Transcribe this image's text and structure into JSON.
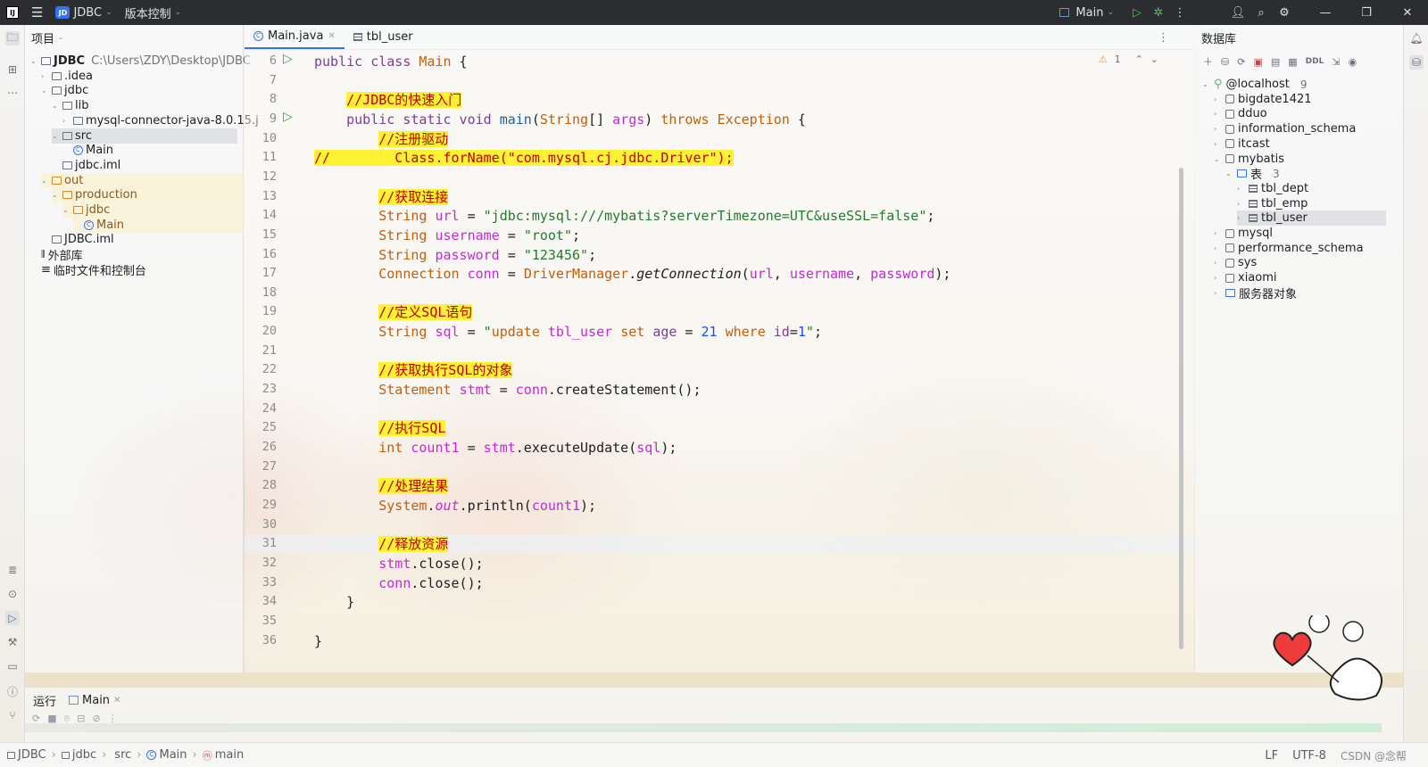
{
  "titlebar": {
    "project_badge": "JD",
    "project": "JDBC",
    "vcs": "版本控制",
    "run_config": "Main"
  },
  "project_panel": {
    "title": "项目",
    "tree": [
      {
        "label": "JDBC",
        "path": "C:\\Users\\ZDY\\Desktop\\JDBC",
        "depth": 0,
        "type": "module",
        "open": true
      },
      {
        "label": ".idea",
        "depth": 1,
        "type": "folder",
        "open": false
      },
      {
        "label": "jdbc",
        "depth": 1,
        "type": "module",
        "open": true
      },
      {
        "label": "lib",
        "depth": 2,
        "type": "folder",
        "open": true
      },
      {
        "label": "mysql-connector-java-8.0.15.j",
        "depth": 3,
        "type": "jar",
        "open": false
      },
      {
        "label": "src",
        "depth": 2,
        "type": "folder",
        "open": true,
        "selected": true
      },
      {
        "label": "Main",
        "depth": 3,
        "type": "class"
      },
      {
        "label": "jdbc.iml",
        "depth": 2,
        "type": "file"
      },
      {
        "label": "out",
        "depth": 1,
        "type": "folder",
        "open": true,
        "excluded": true
      },
      {
        "label": "production",
        "depth": 2,
        "type": "folder",
        "open": true,
        "excluded": true
      },
      {
        "label": "jdbc",
        "depth": 3,
        "type": "folder",
        "open": true,
        "excluded": true
      },
      {
        "label": "Main",
        "depth": 4,
        "type": "class",
        "excluded": true
      },
      {
        "label": "JDBC.iml",
        "depth": 1,
        "type": "file"
      },
      {
        "label": "外部库",
        "depth": 0,
        "type": "lib"
      },
      {
        "label": "临时文件和控制台",
        "depth": 0,
        "type": "scratch"
      }
    ]
  },
  "editor": {
    "tabs": [
      {
        "label": "Main.java",
        "active": true
      },
      {
        "label": "tbl_user",
        "active": false
      }
    ],
    "warnings": "1",
    "line_numbers": [
      "6",
      "7",
      "8",
      "9",
      "10",
      "11",
      "12",
      "13",
      "14",
      "15",
      "16",
      "17",
      "18",
      "19",
      "20",
      "21",
      "22",
      "23",
      "24",
      "25",
      "26",
      "27",
      "28",
      "29",
      "30",
      "31",
      "32",
      "33",
      "34",
      "35",
      "36"
    ],
    "code_lines": [
      [
        [
          "kw",
          "public class "
        ],
        [
          "cls",
          "Main"
        ],
        [
          "",
          " {"
        ]
      ],
      [],
      [
        [
          "",
          "    "
        ],
        [
          "cmt",
          "//JDBC的快速入门"
        ]
      ],
      [
        [
          "",
          "    "
        ],
        [
          "kw",
          "public static void "
        ],
        [
          "fn",
          "main"
        ],
        [
          "",
          "("
        ],
        [
          "cls",
          "String"
        ],
        [
          "",
          "[] "
        ],
        [
          "var",
          "args"
        ],
        [
          "",
          ") "
        ],
        [
          "kwk",
          "throws "
        ],
        [
          "cls",
          "Exception"
        ],
        [
          "",
          " {"
        ]
      ],
      [
        [
          "",
          "        "
        ],
        [
          "cmt",
          "//注册驱动"
        ]
      ],
      [
        [
          "cmt",
          "//        Class.forName(\"com.mysql.cj.jdbc.Driver\");"
        ]
      ],
      [],
      [
        [
          "",
          "        "
        ],
        [
          "cmt",
          "//获取连接"
        ]
      ],
      [
        [
          "",
          "        "
        ],
        [
          "cls",
          "String "
        ],
        [
          "var",
          "url"
        ],
        [
          "",
          " = "
        ],
        [
          "str",
          "\"jdbc:mysql:///mybatis?serverTimezone=UTC&useSSL=false\""
        ],
        [
          "",
          ";"
        ]
      ],
      [
        [
          "",
          "        "
        ],
        [
          "cls",
          "String "
        ],
        [
          "var",
          "username"
        ],
        [
          "",
          " = "
        ],
        [
          "str",
          "\"root\""
        ],
        [
          "",
          ";"
        ]
      ],
      [
        [
          "",
          "        "
        ],
        [
          "cls",
          "String "
        ],
        [
          "var",
          "password"
        ],
        [
          "",
          " = "
        ],
        [
          "str",
          "\"123456\""
        ],
        [
          "",
          ";"
        ]
      ],
      [
        [
          "",
          "        "
        ],
        [
          "cls",
          "Connection "
        ],
        [
          "var",
          "conn"
        ],
        [
          "",
          " = "
        ],
        [
          "cls",
          "DriverManager"
        ],
        [
          "",
          "."
        ],
        [
          "it",
          "getConnection"
        ],
        [
          "",
          "("
        ],
        [
          "var",
          "url"
        ],
        [
          "",
          ", "
        ],
        [
          "var",
          "username"
        ],
        [
          "",
          ", "
        ],
        [
          "var",
          "password"
        ],
        [
          "",
          ");"
        ]
      ],
      [],
      [
        [
          "",
          "        "
        ],
        [
          "cmt",
          "//定义SQL语句"
        ]
      ],
      [
        [
          "",
          "        "
        ],
        [
          "cls",
          "String "
        ],
        [
          "var",
          "sql"
        ],
        [
          "",
          " = "
        ],
        [
          "str",
          "\""
        ],
        [
          "kwk",
          "update "
        ],
        [
          "var",
          "tbl_user "
        ],
        [
          "kwk",
          "set "
        ],
        [
          "kw",
          "age"
        ],
        [
          "",
          " = "
        ],
        [
          "num",
          "21 "
        ],
        [
          "kwk",
          "where "
        ],
        [
          "kw",
          "id"
        ],
        [
          "",
          "="
        ],
        [
          "num",
          "1"
        ],
        [
          "str",
          "\""
        ],
        [
          "",
          ";"
        ]
      ],
      [],
      [
        [
          "",
          "        "
        ],
        [
          "cmt",
          "//获取执行SQL的对象"
        ]
      ],
      [
        [
          "",
          "        "
        ],
        [
          "cls",
          "Statement "
        ],
        [
          "var",
          "stmt"
        ],
        [
          "",
          " = "
        ],
        [
          "var",
          "conn"
        ],
        [
          "",
          ".createStatement();"
        ]
      ],
      [],
      [
        [
          "",
          "        "
        ],
        [
          "cmt",
          "//执行SQL"
        ]
      ],
      [
        [
          "",
          "        "
        ],
        [
          "kwk",
          "int "
        ],
        [
          "var",
          "count1"
        ],
        [
          "",
          " = "
        ],
        [
          "var",
          "stmt"
        ],
        [
          "",
          ".executeUpdate("
        ],
        [
          "var",
          "sql"
        ],
        [
          "",
          ");"
        ]
      ],
      [],
      [
        [
          "",
          "        "
        ],
        [
          "cmt",
          "//处理结果"
        ]
      ],
      [
        [
          "",
          "        "
        ],
        [
          "cls",
          "System"
        ],
        [
          "",
          "."
        ],
        [
          "var it",
          "out"
        ],
        [
          "",
          ".println("
        ],
        [
          "var",
          "count1"
        ],
        [
          "",
          ");"
        ]
      ],
      [],
      [
        [
          "",
          "        "
        ],
        [
          "cmt",
          "//释放资源"
        ]
      ],
      [
        [
          "",
          "        "
        ],
        [
          "var",
          "stmt"
        ],
        [
          "",
          ".close();"
        ]
      ],
      [
        [
          "",
          "        "
        ],
        [
          "var",
          "conn"
        ],
        [
          "",
          ".close();"
        ]
      ],
      [
        [
          "",
          "    }"
        ]
      ],
      [],
      [
        [
          "",
          "}"
        ]
      ]
    ]
  },
  "database_panel": {
    "title": "数据库",
    "toolbar_ddl": "DDL",
    "tree": [
      {
        "label": "@localhost",
        "count": "9",
        "depth": 0,
        "open": true,
        "type": "server"
      },
      {
        "label": "bigdate1421",
        "depth": 1,
        "type": "schema"
      },
      {
        "label": "dduo",
        "depth": 1,
        "type": "schema"
      },
      {
        "label": "information_schema",
        "depth": 1,
        "type": "schema"
      },
      {
        "label": "itcast",
        "depth": 1,
        "type": "schema"
      },
      {
        "label": "mybatis",
        "depth": 1,
        "type": "schema",
        "open": true
      },
      {
        "label": "表",
        "count": "3",
        "depth": 2,
        "type": "folder",
        "open": true
      },
      {
        "label": "tbl_dept",
        "depth": 3,
        "type": "table"
      },
      {
        "label": "tbl_emp",
        "depth": 3,
        "type": "table"
      },
      {
        "label": "tbl_user",
        "depth": 3,
        "type": "table",
        "selected": true
      },
      {
        "label": "mysql",
        "depth": 1,
        "type": "schema"
      },
      {
        "label": "performance_schema",
        "depth": 1,
        "type": "schema"
      },
      {
        "label": "sys",
        "depth": 1,
        "type": "schema"
      },
      {
        "label": "xiaomi",
        "depth": 1,
        "type": "schema"
      },
      {
        "label": "服务器对象",
        "depth": 1,
        "type": "folder"
      }
    ]
  },
  "run_panel": {
    "title": "运行",
    "tab": "Main"
  },
  "statusbar": {
    "breadcrumb": [
      "JDBC",
      "jdbc",
      "src",
      "Main",
      "main"
    ],
    "line_sep": "LF",
    "encoding": "UTF-8",
    "watermark": "CSDN @念帮"
  }
}
